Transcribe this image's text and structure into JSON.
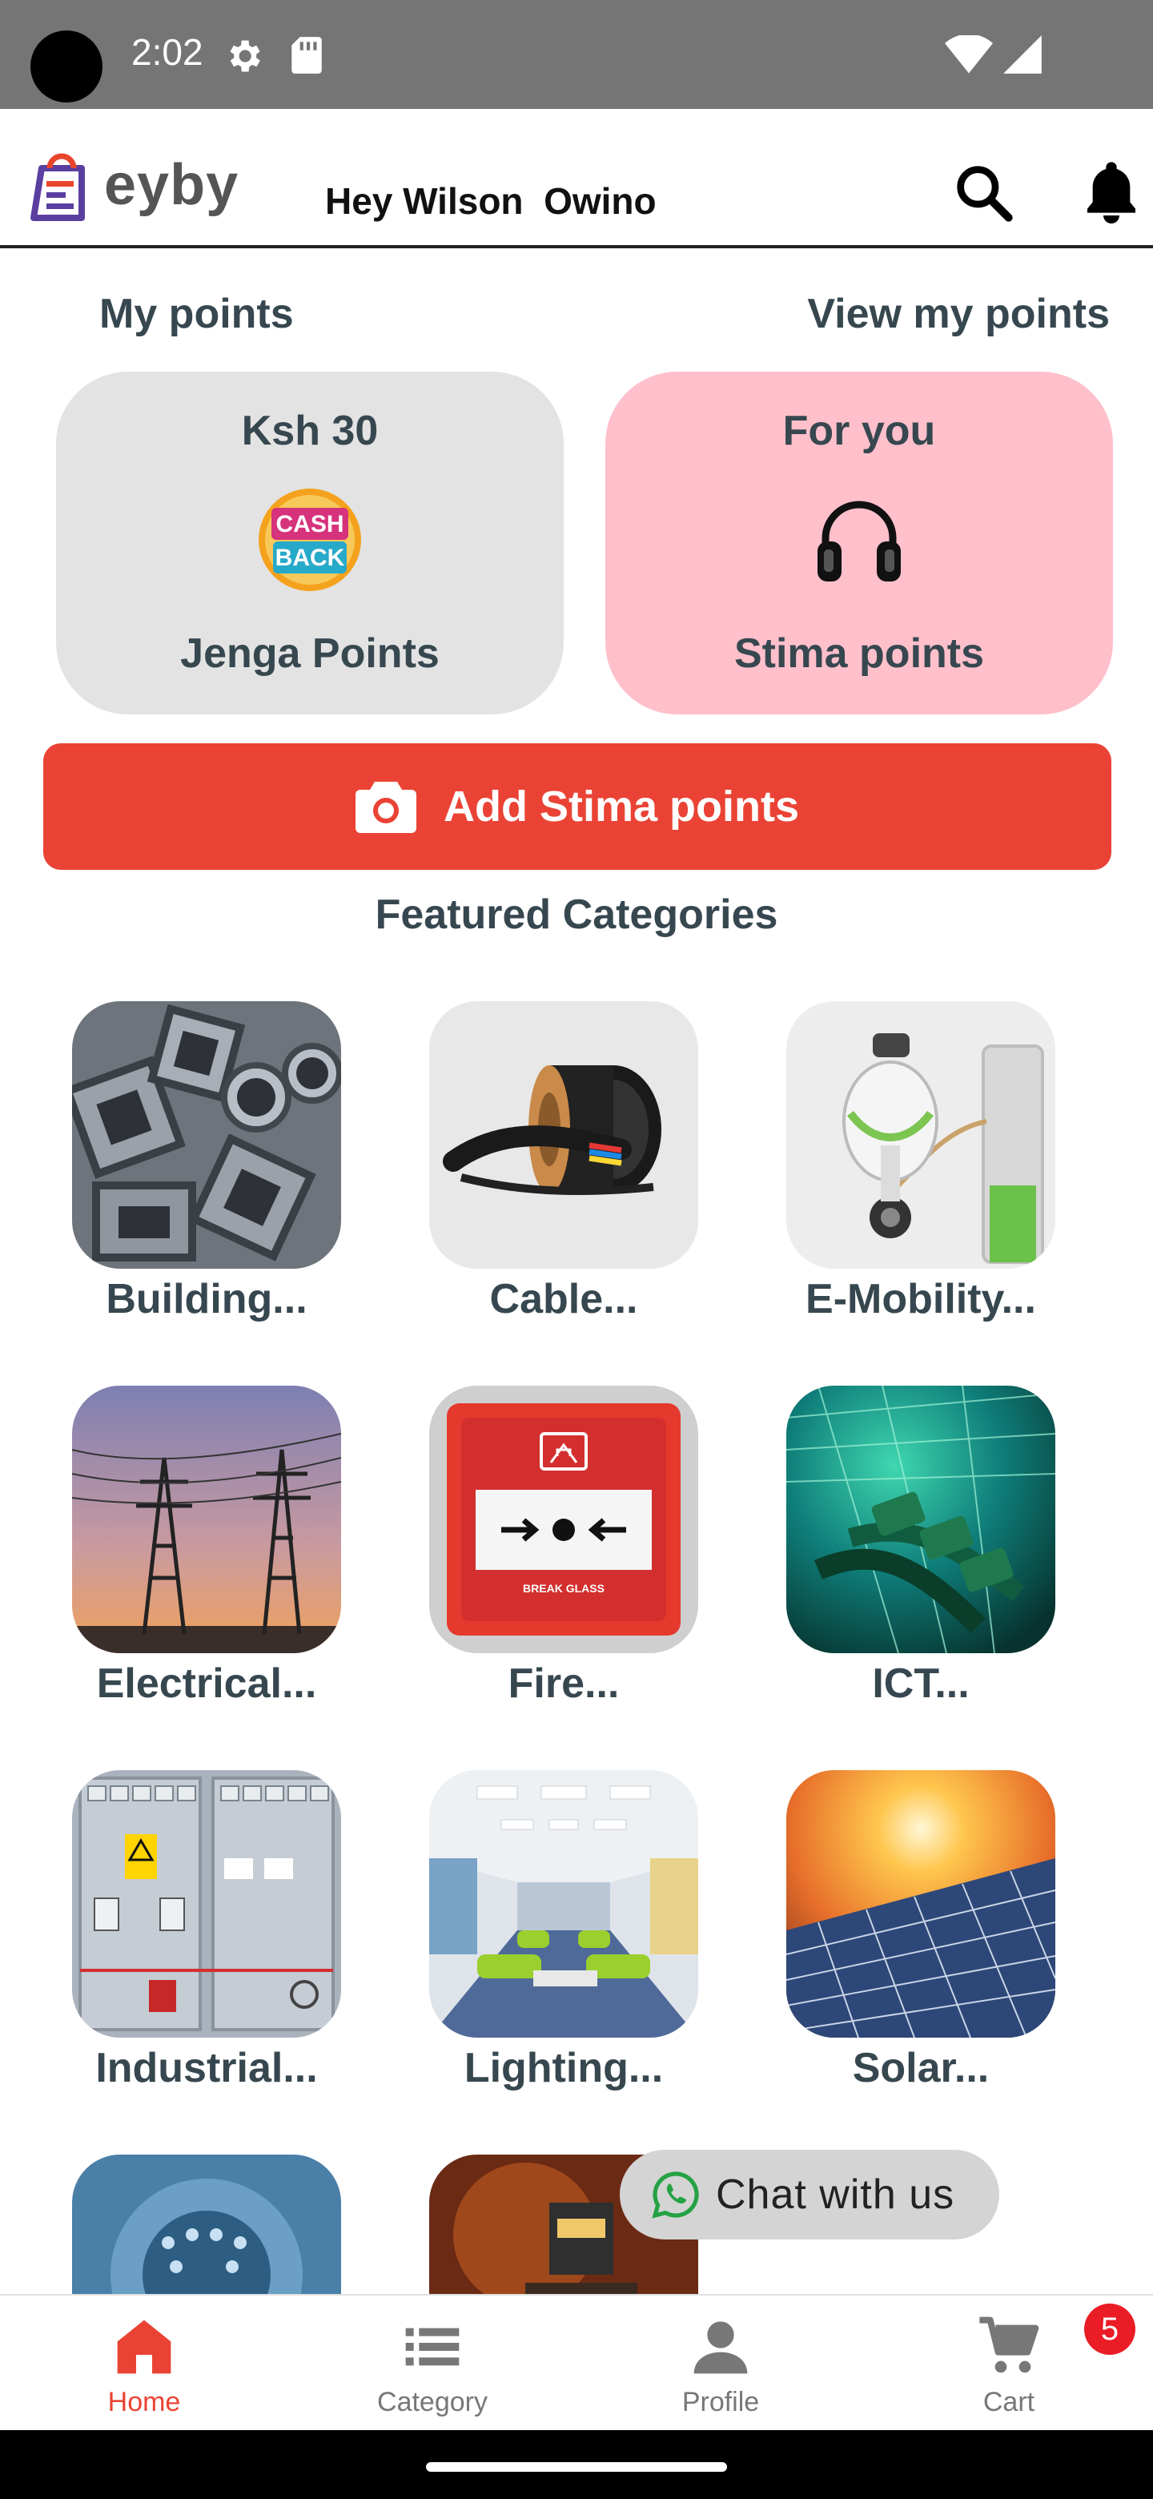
{
  "status_bar": {
    "time": "2:02"
  },
  "header": {
    "logo_text": "eyby",
    "greeting": "Hey Wilson  Owino"
  },
  "points": {
    "title": "My points",
    "view_link": "View my points",
    "cards": [
      {
        "top": "Ksh 30",
        "icon": "cashback-icon",
        "icon_text_1": "CASH",
        "icon_text_2": "BACK",
        "bottom": "Jenga Points",
        "color": "#e3e3e3"
      },
      {
        "top": "For you",
        "icon": "headphones-icon",
        "bottom": "Stima points",
        "color": "#ffc0cb"
      }
    ],
    "add_button": "Add Stima points"
  },
  "featured": {
    "title": "Featured Categories",
    "categories": [
      {
        "label": "Building...",
        "icon": "metal-pipes-image"
      },
      {
        "label": "Cable...",
        "icon": "cable-reel-image"
      },
      {
        "label": "E-Mobility...",
        "icon": "e-scooter-charger-image"
      },
      {
        "label": "Electrical...",
        "icon": "power-pylons-image"
      },
      {
        "label": "Fire...",
        "icon": "fire-alarm-image",
        "image_text": "BREAK GLASS"
      },
      {
        "label": "ICT...",
        "icon": "fiber-network-image"
      },
      {
        "label": "Industrial...",
        "icon": "switchgear-panel-image"
      },
      {
        "label": "Lighting...",
        "icon": "office-lighting-image"
      },
      {
        "label": "Solar...",
        "icon": "solar-panel-image"
      },
      {
        "label": "",
        "icon": "circuit-closeup-image"
      },
      {
        "label": "",
        "icon": "welder-image"
      }
    ]
  },
  "chat": {
    "label": "Chat with us"
  },
  "bottom_nav": {
    "items": [
      {
        "label": "Home",
        "icon": "home-icon",
        "active": true
      },
      {
        "label": "Category",
        "icon": "list-icon",
        "active": false
      },
      {
        "label": "Profile",
        "icon": "person-icon",
        "active": false
      },
      {
        "label": "Cart",
        "icon": "cart-icon",
        "active": false
      }
    ],
    "cart_count": "5"
  },
  "colors": {
    "accent": "#ea4335",
    "text": "#37474f",
    "stima_card": "#ffc0cb",
    "jenga_card": "#e3e3e3"
  }
}
